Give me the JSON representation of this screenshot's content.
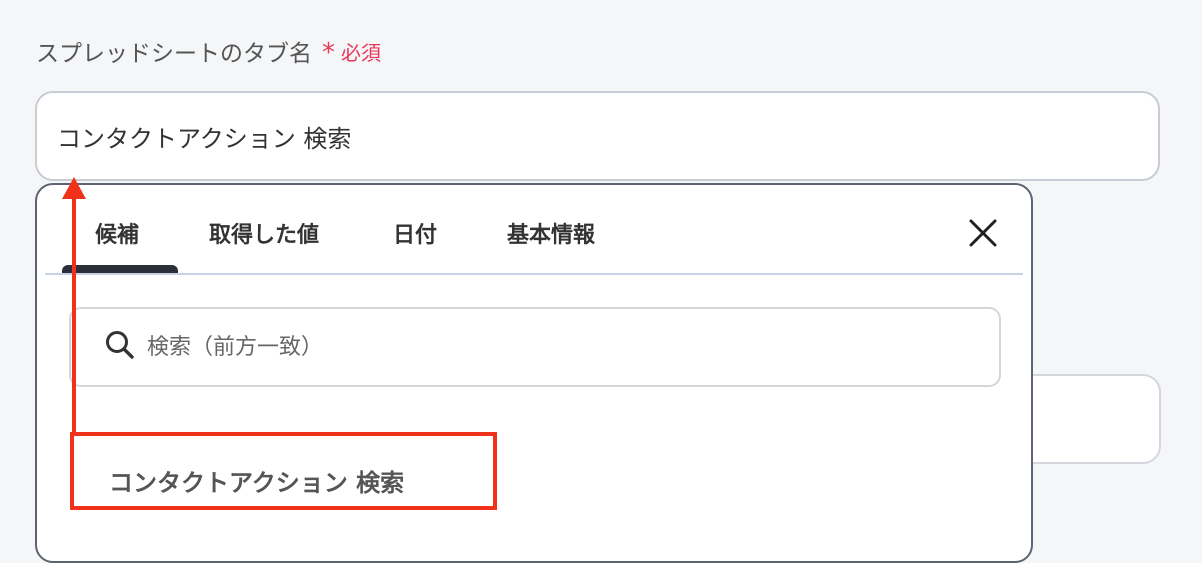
{
  "field": {
    "label": "スプレッドシートのタブ名",
    "required_mark": "*",
    "required_text": "必須",
    "value": "コンタクトアクション 検索"
  },
  "dropdown": {
    "tabs": [
      {
        "label": "候補",
        "active": true
      },
      {
        "label": "取得した値",
        "active": false
      },
      {
        "label": "日付",
        "active": false
      },
      {
        "label": "基本情報",
        "active": false
      }
    ],
    "close_icon": "close-icon",
    "search": {
      "placeholder": "検索（前方一致）",
      "icon": "search-icon"
    },
    "candidates": [
      "コンタクトアクション 検索"
    ]
  },
  "annotation": {
    "color": "#f0321a"
  },
  "colors": {
    "required": "#e8375a",
    "tab_underline": "#2a2f3a"
  }
}
